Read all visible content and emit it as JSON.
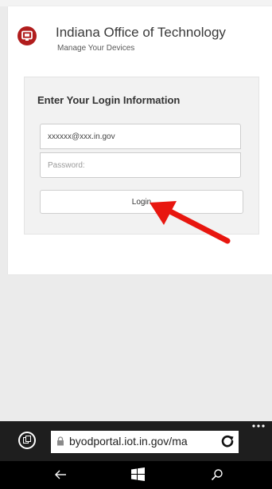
{
  "header": {
    "org_name": "Indiana Office of Technology",
    "subtitle": "Manage Your Devices",
    "logo_color": "#b11d1d"
  },
  "login": {
    "heading": "Enter Your Login Information",
    "email_value": "xxxxxx@xxx.in.gov",
    "password_placeholder": "Password:",
    "button_label": "Login"
  },
  "annotation": {
    "arrow_color": "#e8160f"
  },
  "browser": {
    "url": "byodportal.iot.in.gov/ma",
    "tabs_icon": "tabs-icon",
    "lock_icon": "lock-icon",
    "refresh_icon": "refresh-icon",
    "more_icon": "more-options-icon"
  },
  "navbar": {
    "back_icon": "back-arrow-icon",
    "home_icon": "windows-start-icon",
    "search_icon": "search-icon"
  }
}
